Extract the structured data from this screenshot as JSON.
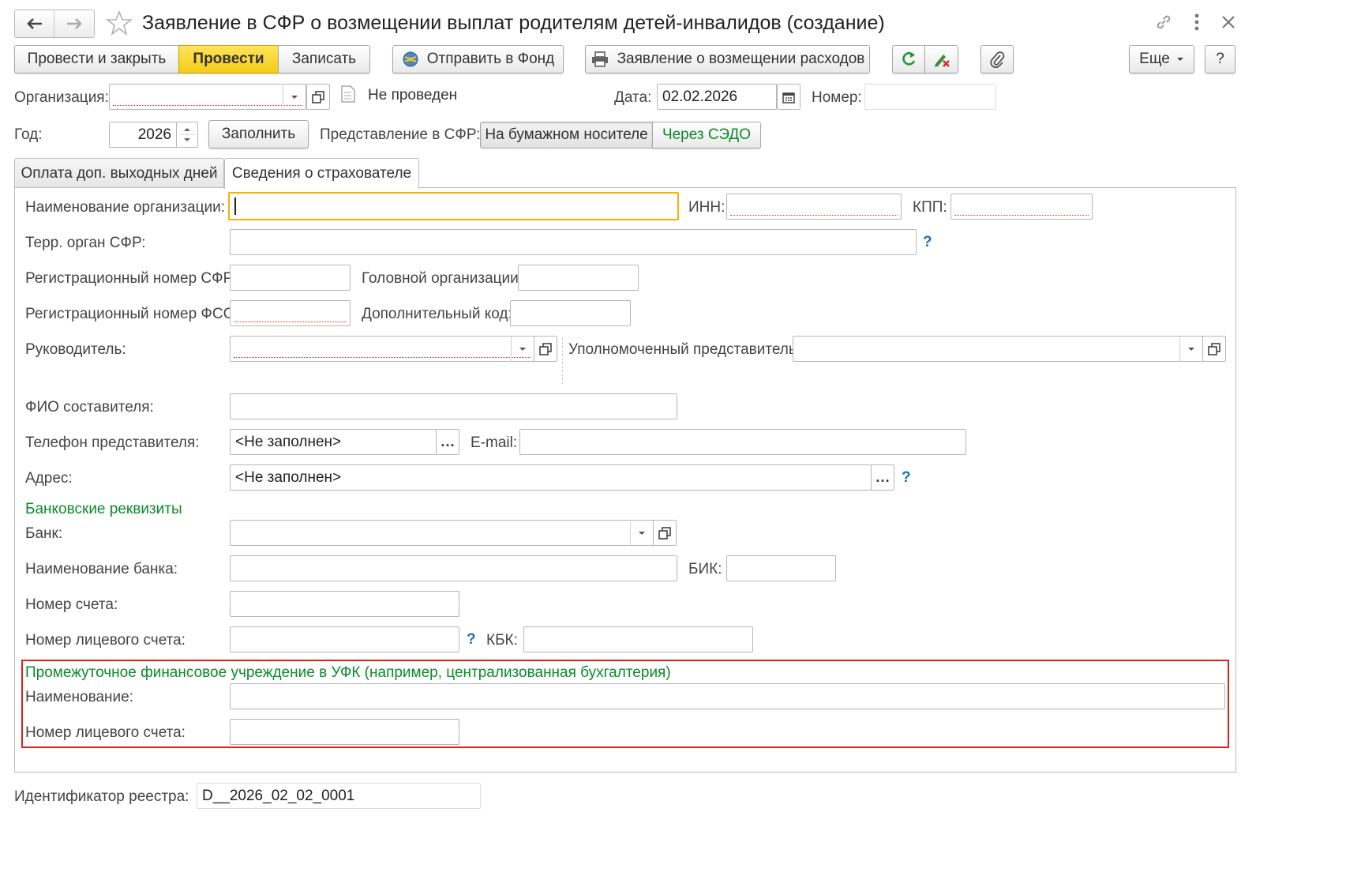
{
  "header": {
    "title": "Заявление в СФР о возмещении выплат родителям детей-инвалидов (создание)"
  },
  "toolbar": {
    "post_close": "Провести и закрыть",
    "post": "Провести",
    "save": "Записать",
    "send_fund": "Отправить в Фонд",
    "report": "Заявление о возмещении расходов",
    "more": "Еще",
    "help": "?"
  },
  "form": {
    "org_label": "Организация:",
    "status": "Не проведен",
    "date_label": "Дата:",
    "date_value": "02.02.2026",
    "number_label": "Номер:",
    "year_label": "Год:",
    "year_value": "2026",
    "fill_button": "Заполнить",
    "presentation_label": "Представление в СФР:",
    "presentation_options": [
      "На бумажном носителе",
      "Через СЭДО"
    ]
  },
  "tabs": [
    "Оплата доп. выходных дней",
    "Сведения о страхователе"
  ],
  "insurer": {
    "org_name_label": "Наименование организации:",
    "inn_label": "ИНН:",
    "kpp_label": "КПП:",
    "terr_label": "Терр. орган СФР:",
    "reg_sfr_label": "Регистрационный номер СФР:",
    "head_org_label": "Головной организации:",
    "reg_fss_label": "Регистрационный номер ФСС:",
    "add_code_label": "Дополнительный код:",
    "head_label": "Руководитель:",
    "rep_label": "Уполномоченный представитель:",
    "compiler_label": "ФИО составителя:",
    "phone_label": "Телефон представителя:",
    "phone_value": "<Не заполнен>",
    "email_label": "E-mail:",
    "address_label": "Адрес:",
    "address_value": "<Не заполнен>",
    "bank_section": "Банковские реквизиты",
    "bank_label": "Банк:",
    "bank_name_label": "Наименование банка:",
    "bik_label": "БИК:",
    "account_label": "Номер счета:",
    "personal_account_label": "Номер лицевого счета:",
    "kbk_label": "КБК:",
    "intermediate_section": "Промежуточное финансовое учреждение в УФК (например, централизованная бухгалтерия)",
    "inter_name_label": "Наименование:",
    "inter_account_label": "Номер лицевого счета:"
  },
  "footer": {
    "registry_label": "Идентификатор реестра:",
    "registry_value": "D__2026_02_02_0001"
  },
  "colors": {
    "accent_yellow": "#f5cc16",
    "section_green": "#0a8a2a",
    "highlight_red": "#e0201a",
    "help_blue": "#1a6fc4"
  }
}
